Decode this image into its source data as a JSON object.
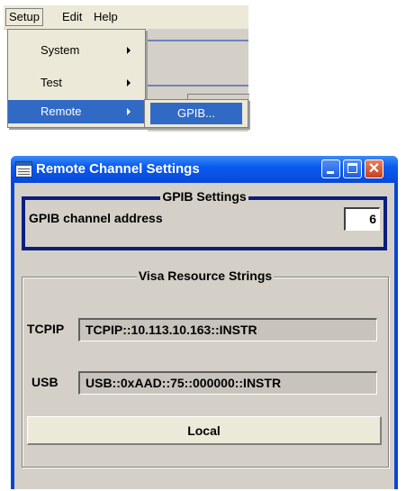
{
  "menubar": {
    "items": [
      {
        "label": "Setup"
      },
      {
        "label": "Edit"
      },
      {
        "label": "Help"
      }
    ]
  },
  "setup_menu": {
    "items": [
      {
        "label": "System",
        "has_submenu": true
      },
      {
        "label": "Test",
        "has_submenu": true
      },
      {
        "label": "Remote",
        "has_submenu": true,
        "highlighted": true
      }
    ]
  },
  "remote_submenu": {
    "items": [
      {
        "label": "GPIB...",
        "highlighted": true
      }
    ]
  },
  "dialog": {
    "title": "Remote Channel Settings",
    "icon": "window-settings-icon",
    "gpib": {
      "legend": "GPIB Settings",
      "channel_label": "GPIB channel address",
      "channel_value": "6"
    },
    "visa": {
      "legend": "Visa Resource Strings",
      "tcpip_label": "TCPIP",
      "tcpip_value": "TCPIP::10.113.10.163::INSTR",
      "usb_label": "USB",
      "usb_value": "USB::0xAAD::75::000000::INSTR"
    },
    "local_button": "Local"
  },
  "colors": {
    "titlebar": "#0a5bf0",
    "highlight": "#316ac5",
    "close_button": "#c8401c",
    "gpib_border": "#0b1e7d",
    "client_bg": "#d4d0c8"
  }
}
